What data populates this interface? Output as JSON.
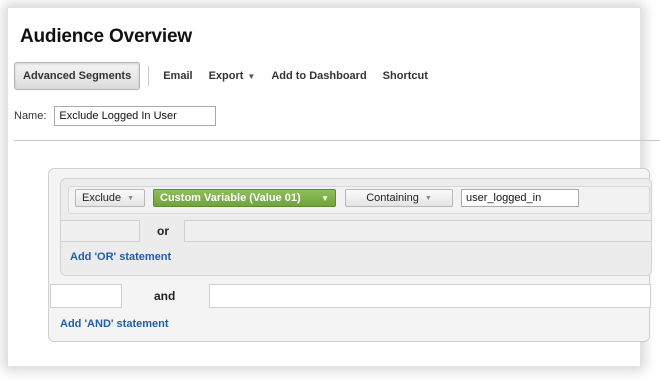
{
  "page": {
    "title": "Audience Overview"
  },
  "toolbar": {
    "advanced_segments": "Advanced Segments",
    "email": "Email",
    "export": "Export",
    "add_to_dashboard": "Add to Dashboard",
    "shortcut": "Shortcut"
  },
  "segment": {
    "name_label": "Name:",
    "name_value": "Exclude Logged In User"
  },
  "condition": {
    "include_exclude": "Exclude",
    "dimension": "Custom Variable (Value 01)",
    "match_type": "Containing",
    "value": "user_logged_in"
  },
  "logic": {
    "or_label": "or",
    "add_or": "Add 'OR' statement",
    "and_label": "and",
    "add_and": "Add 'AND' statement"
  },
  "colors": {
    "dimension_green": "#7bb046",
    "link_blue": "#1f5ea8"
  },
  "icons": {
    "dropdown": "chevron-down-icon"
  }
}
